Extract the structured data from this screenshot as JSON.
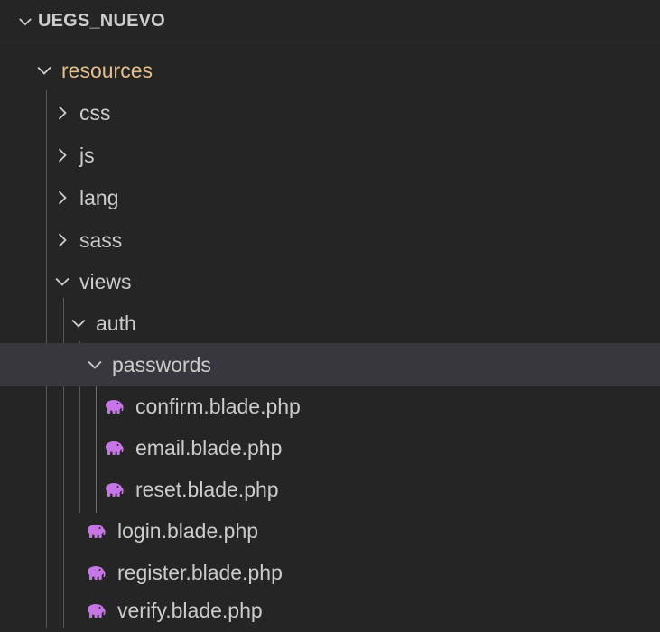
{
  "explorer": {
    "workspace_title": "UEGS_NUEVO",
    "tree": {
      "resources": "resources",
      "css": "css",
      "js": "js",
      "lang": "lang",
      "sass": "sass",
      "views": "views",
      "auth": "auth",
      "passwords": "passwords",
      "confirm": "confirm.blade.php",
      "email": "email.blade.php",
      "reset": "reset.blade.php",
      "login": "login.blade.php",
      "register": "register.blade.php",
      "verify": "verify.blade.php"
    },
    "colors": {
      "background": "#252526",
      "selected_row": "#37373d",
      "folder_text": "#cccccc",
      "resources_text": "#e2c08d",
      "blade_icon": "#c875e8"
    },
    "icons": {
      "expanded": "chevron-down-icon",
      "collapsed": "chevron-right-icon",
      "blade_file": "elephant-icon"
    }
  }
}
